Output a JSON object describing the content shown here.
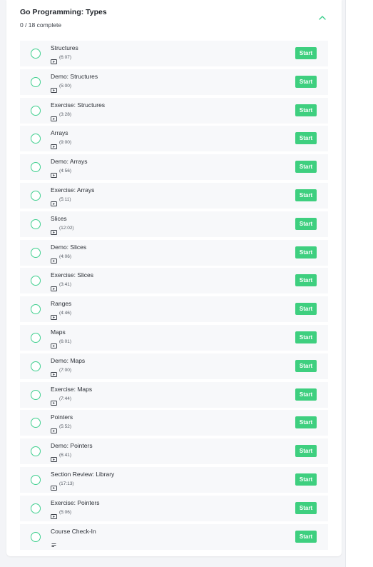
{
  "section": {
    "title": "Go Programming: Types",
    "progress": "0 / 18 complete",
    "expanded": true
  },
  "colors": {
    "accent": "#3ecf7f",
    "circle": "#3ecf8e",
    "row_bg": "#f7f8fa"
  },
  "lessons": [
    {
      "title": "Structures",
      "duration": "(6:07)",
      "type": "video-icon",
      "action": "Start"
    },
    {
      "title": "Demo: Structures",
      "duration": "(5:00)",
      "type": "video-icon",
      "action": "Start"
    },
    {
      "title": "Exercise: Structures",
      "duration": "(3:28)",
      "type": "video-icon",
      "action": "Start"
    },
    {
      "title": "Arrays",
      "duration": "(9:00)",
      "type": "video-icon",
      "action": "Start"
    },
    {
      "title": "Demo: Arrays",
      "duration": "(4:56)",
      "type": "video-icon",
      "action": "Start"
    },
    {
      "title": "Exercise: Arrays",
      "duration": "(5:11)",
      "type": "video-icon",
      "action": "Start"
    },
    {
      "title": "Slices",
      "duration": "(12:02)",
      "type": "video-icon",
      "action": "Start"
    },
    {
      "title": "Demo: Slices",
      "duration": "(4:06)",
      "type": "video-icon",
      "action": "Start"
    },
    {
      "title": "Exercise: Slices",
      "duration": "(3:41)",
      "type": "video-icon",
      "action": "Start"
    },
    {
      "title": "Ranges",
      "duration": "(4:46)",
      "type": "video-icon",
      "action": "Start"
    },
    {
      "title": "Maps",
      "duration": "(6:01)",
      "type": "video-icon",
      "action": "Start"
    },
    {
      "title": "Demo: Maps",
      "duration": "(7:00)",
      "type": "video-icon",
      "action": "Start"
    },
    {
      "title": "Exercise: Maps",
      "duration": "(7:44)",
      "type": "video-icon",
      "action": "Start"
    },
    {
      "title": "Pointers",
      "duration": "(5:52)",
      "type": "video-icon",
      "action": "Start"
    },
    {
      "title": "Demo: Pointers",
      "duration": "(6:41)",
      "type": "video-icon",
      "action": "Start"
    },
    {
      "title": "Section Review: Library",
      "duration": "(17:13)",
      "type": "video-icon",
      "action": "Start"
    },
    {
      "title": "Exercise: Pointers",
      "duration": "(5:06)",
      "type": "video-icon",
      "action": "Start"
    },
    {
      "title": "Course Check-In",
      "duration": "",
      "type": "text-icon",
      "action": "Start"
    }
  ]
}
